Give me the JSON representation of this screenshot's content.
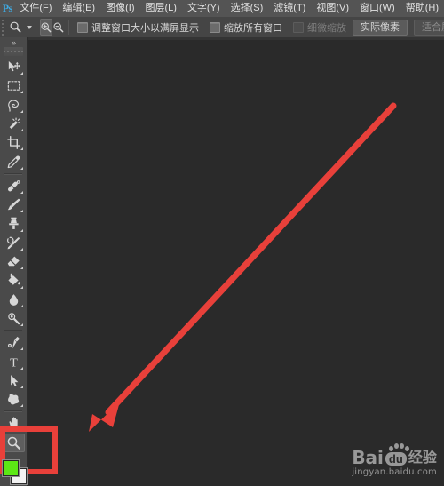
{
  "app": {
    "name": "Adobe Photoshop",
    "logo_text": "Ps"
  },
  "menubar": {
    "items": [
      {
        "label": "文件(F)",
        "name": "menu-file"
      },
      {
        "label": "编辑(E)",
        "name": "menu-edit"
      },
      {
        "label": "图像(I)",
        "name": "menu-image"
      },
      {
        "label": "图层(L)",
        "name": "menu-layer"
      },
      {
        "label": "文字(Y)",
        "name": "menu-type"
      },
      {
        "label": "选择(S)",
        "name": "menu-select"
      },
      {
        "label": "滤镜(T)",
        "name": "menu-filter"
      },
      {
        "label": "视图(V)",
        "name": "menu-view"
      },
      {
        "label": "窗口(W)",
        "name": "menu-window"
      },
      {
        "label": "帮助(H)",
        "name": "menu-help"
      }
    ]
  },
  "options_bar": {
    "tool_preset_icon": "zoom-tool-icon",
    "zoom_in_label": "zoom-in",
    "zoom_out_label": "zoom-out",
    "zoom_in_active": true,
    "checkbox_resize_window": {
      "label": "调整窗口大小以满屏显示",
      "checked": false,
      "enabled": true
    },
    "checkbox_zoom_all_windows": {
      "label": "缩放所有窗口",
      "checked": false,
      "enabled": true
    },
    "checkbox_scrubby_zoom": {
      "label": "细微缩放",
      "checked": false,
      "enabled": false
    },
    "button_actual_pixels": {
      "label": "实际像素",
      "enabled": true
    },
    "button_fit_screen": {
      "label": "适合屏幕",
      "enabled": false
    }
  },
  "toolbar": {
    "collapse_icon": "double-chevron-right-icon",
    "tools": [
      {
        "name": "move-tool",
        "label": "移动工具",
        "has_flyout": true,
        "active": false
      },
      {
        "name": "rectangular-marquee-tool",
        "label": "矩形选框工具",
        "has_flyout": true,
        "active": false
      },
      {
        "name": "lasso-tool",
        "label": "套索工具",
        "has_flyout": true,
        "active": false
      },
      {
        "name": "magic-wand-tool",
        "label": "魔棒工具",
        "has_flyout": true,
        "active": false
      },
      {
        "name": "crop-tool",
        "label": "裁剪工具",
        "has_flyout": true,
        "active": false
      },
      {
        "name": "eyedropper-tool",
        "label": "吸管工具",
        "has_flyout": true,
        "active": false
      },
      {
        "name": "healing-brush-tool",
        "label": "污点修复画笔工具",
        "has_flyout": true,
        "active": false
      },
      {
        "name": "brush-tool",
        "label": "画笔工具",
        "has_flyout": true,
        "active": false
      },
      {
        "name": "clone-stamp-tool",
        "label": "仿制图章工具",
        "has_flyout": true,
        "active": false
      },
      {
        "name": "history-brush-tool",
        "label": "历史记录画笔工具",
        "has_flyout": true,
        "active": false
      },
      {
        "name": "eraser-tool",
        "label": "橡皮擦工具",
        "has_flyout": true,
        "active": false
      },
      {
        "name": "gradient-tool",
        "label": "渐变工具",
        "has_flyout": true,
        "active": false
      },
      {
        "name": "blur-tool",
        "label": "模糊工具",
        "has_flyout": true,
        "active": false
      },
      {
        "name": "dodge-tool",
        "label": "减淡工具",
        "has_flyout": true,
        "active": false
      },
      {
        "name": "pen-tool",
        "label": "钢笔工具",
        "has_flyout": true,
        "active": false
      },
      {
        "name": "type-tool",
        "label": "横排文字工具",
        "has_flyout": true,
        "active": false
      },
      {
        "name": "path-selection-tool",
        "label": "路径选择工具",
        "has_flyout": true,
        "active": false
      },
      {
        "name": "custom-shape-tool",
        "label": "自定形状工具",
        "has_flyout": true,
        "active": false
      },
      {
        "name": "hand-tool",
        "label": "抓手工具",
        "has_flyout": true,
        "active": false
      },
      {
        "name": "zoom-tool",
        "label": "缩放工具",
        "has_flyout": false,
        "active": true
      }
    ],
    "colors": {
      "foreground_label": "前景色",
      "foreground_hex": "#5ce815",
      "background_label": "背景色",
      "background_hex": "#f2f2f2"
    }
  },
  "annotation": {
    "arrow_color": "#e8403a",
    "highlight_color": "#e8403a",
    "arrow_from": "445,118",
    "arrow_to": "100,486",
    "highlight_target": "foreground-background-color-swatches"
  },
  "watermark": {
    "brand_bai": "Bai",
    "brand_du": "du",
    "brand_suffix": "经验",
    "url": "jingyan.baidu.com"
  }
}
